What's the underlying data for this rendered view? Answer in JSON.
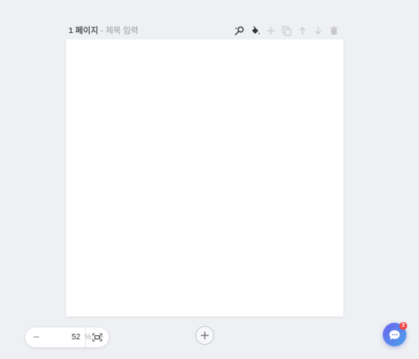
{
  "page": {
    "number": "1 페이지",
    "separator": " - ",
    "title_placeholder": "제목 입력"
  },
  "toolbar": {
    "icons": [
      "magic-wand-icon",
      "paint-bucket-icon",
      "plus-icon",
      "duplicate-icon",
      "arrow-up-icon",
      "arrow-down-icon",
      "trash-icon"
    ]
  },
  "zoom": {
    "value": "52",
    "unit": "%"
  },
  "chat": {
    "badge_count": "3"
  },
  "colors": {
    "background": "#eef0f3",
    "canvas": "#ffffff",
    "icon_active": "#333333",
    "icon_disabled": "#c7c7cc",
    "chat_gradient_start": "#6b63ee",
    "chat_gradient_end": "#4aa3ea",
    "badge": "#f04848"
  }
}
